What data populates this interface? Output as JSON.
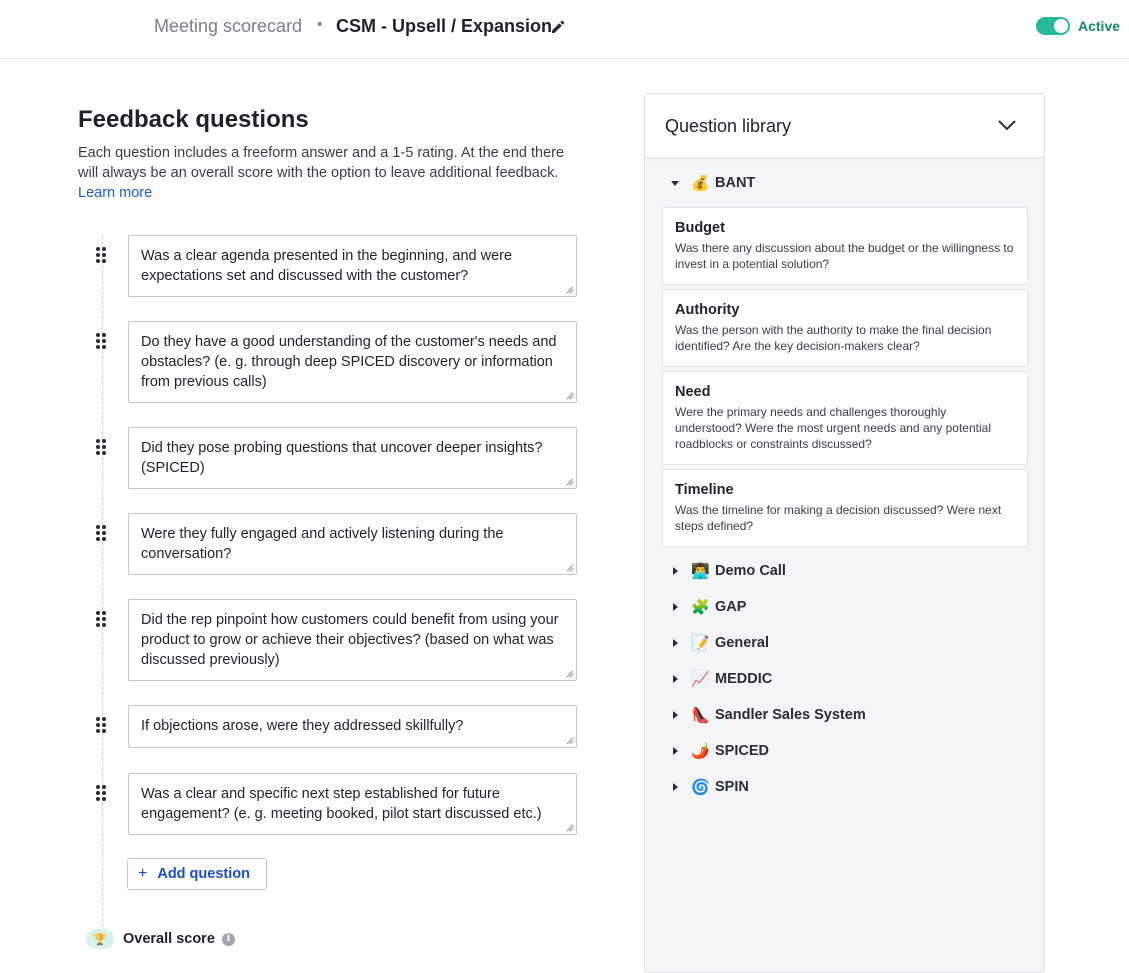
{
  "header": {
    "parent": "Meeting scorecard",
    "separator": "•",
    "title": "CSM - Upsell / Expansion",
    "status_label": "Active",
    "status_on": true,
    "accent_color": "#26b99a"
  },
  "feedback": {
    "title": "Feedback questions",
    "description": "Each question includes a freeform answer and a 1-5 rating. At the end there will always be an overall score with the option to leave additional feedback.",
    "learn_more": "Learn more",
    "questions": [
      "Was a clear agenda presented in the beginning, and were expectations set and discussed with the customer?",
      "Do they have a good understanding of the customer's needs and obstacles? (e. g. through deep SPICED discovery or information from previous calls)",
      "Did they pose probing questions that uncover deeper insights? (SPICED)",
      "Were they fully engaged and actively listening during the conversation?",
      "Did the rep pinpoint how customers could benefit from using your product to grow or achieve their objectives? (based on what was discussed previously)",
      "If objections arose, were they addressed skillfully?",
      "Was a clear and specific next step established for future engagement? (e. g. meeting booked, pilot start discussed etc.)"
    ],
    "add_question": "Add question",
    "overall_score": "Overall score"
  },
  "library": {
    "title": "Question library",
    "groups": [
      {
        "emoji": "💰",
        "name": "BANT",
        "expanded": true
      },
      {
        "emoji": "👨‍💻",
        "name": "Demo Call",
        "expanded": false
      },
      {
        "emoji": "🧩",
        "name": "GAP",
        "expanded": false
      },
      {
        "emoji": "📝",
        "name": "General",
        "expanded": false
      },
      {
        "emoji": "📈",
        "name": "MEDDIC",
        "expanded": false
      },
      {
        "emoji": "👠",
        "name": "Sandler Sales System",
        "expanded": false
      },
      {
        "emoji": "🌶️",
        "name": "SPICED",
        "expanded": false
      },
      {
        "emoji": "🌀",
        "name": "SPIN",
        "expanded": false
      }
    ],
    "bant_items": [
      {
        "title": "Budget",
        "desc": "Was there any discussion about the budget or the willingness to invest in a potential solution?"
      },
      {
        "title": "Authority",
        "desc": "Was the person with the authority to make the final decision identified? Are the key decision-makers clear?"
      },
      {
        "title": "Need",
        "desc": "Were the primary needs and challenges thoroughly understood? Were the most urgent needs and any potential roadblocks or constraints discussed?"
      },
      {
        "title": "Timeline",
        "desc": "Was the timeline for making a decision discussed? Were next steps defined?"
      }
    ]
  }
}
